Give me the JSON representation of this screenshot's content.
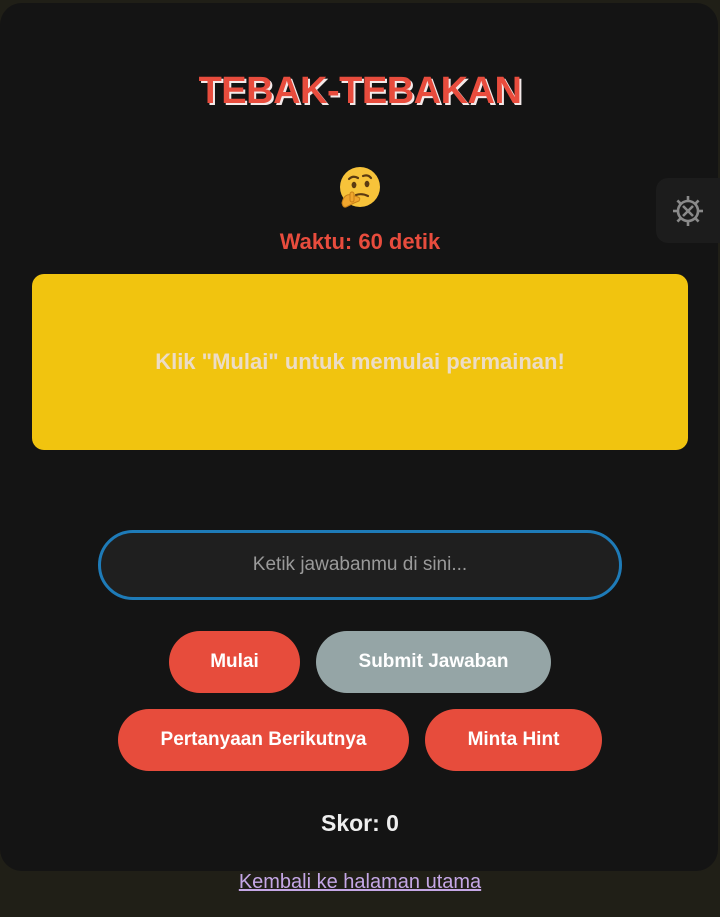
{
  "game": {
    "title": "TEBAK-TEBAKAN",
    "emoji": "🤔",
    "timer_text": "Waktu: 60 detik",
    "question_text": "Klik \"Mulai\" untuk memulai permainan!",
    "answer_placeholder": "Ketik jawabanmu di sini...",
    "answer_value": "",
    "score_text": "Skor: 0"
  },
  "buttons": {
    "start_label": "Mulai",
    "submit_label": "Submit Jawaban",
    "next_label": "Pertanyaan Berikutnya",
    "hint_label": "Minta Hint"
  },
  "footer": {
    "back_link": "Kembali ke halaman utama"
  },
  "icons": {
    "face": "thinking-face-icon",
    "settings": "settings-gear-icon"
  },
  "colors": {
    "accent_red": "#e74c3c",
    "question_bg": "#f1c40f",
    "submit_grey": "#95a5a6",
    "input_border": "#1e7bb8",
    "card_bg": "#141414"
  }
}
